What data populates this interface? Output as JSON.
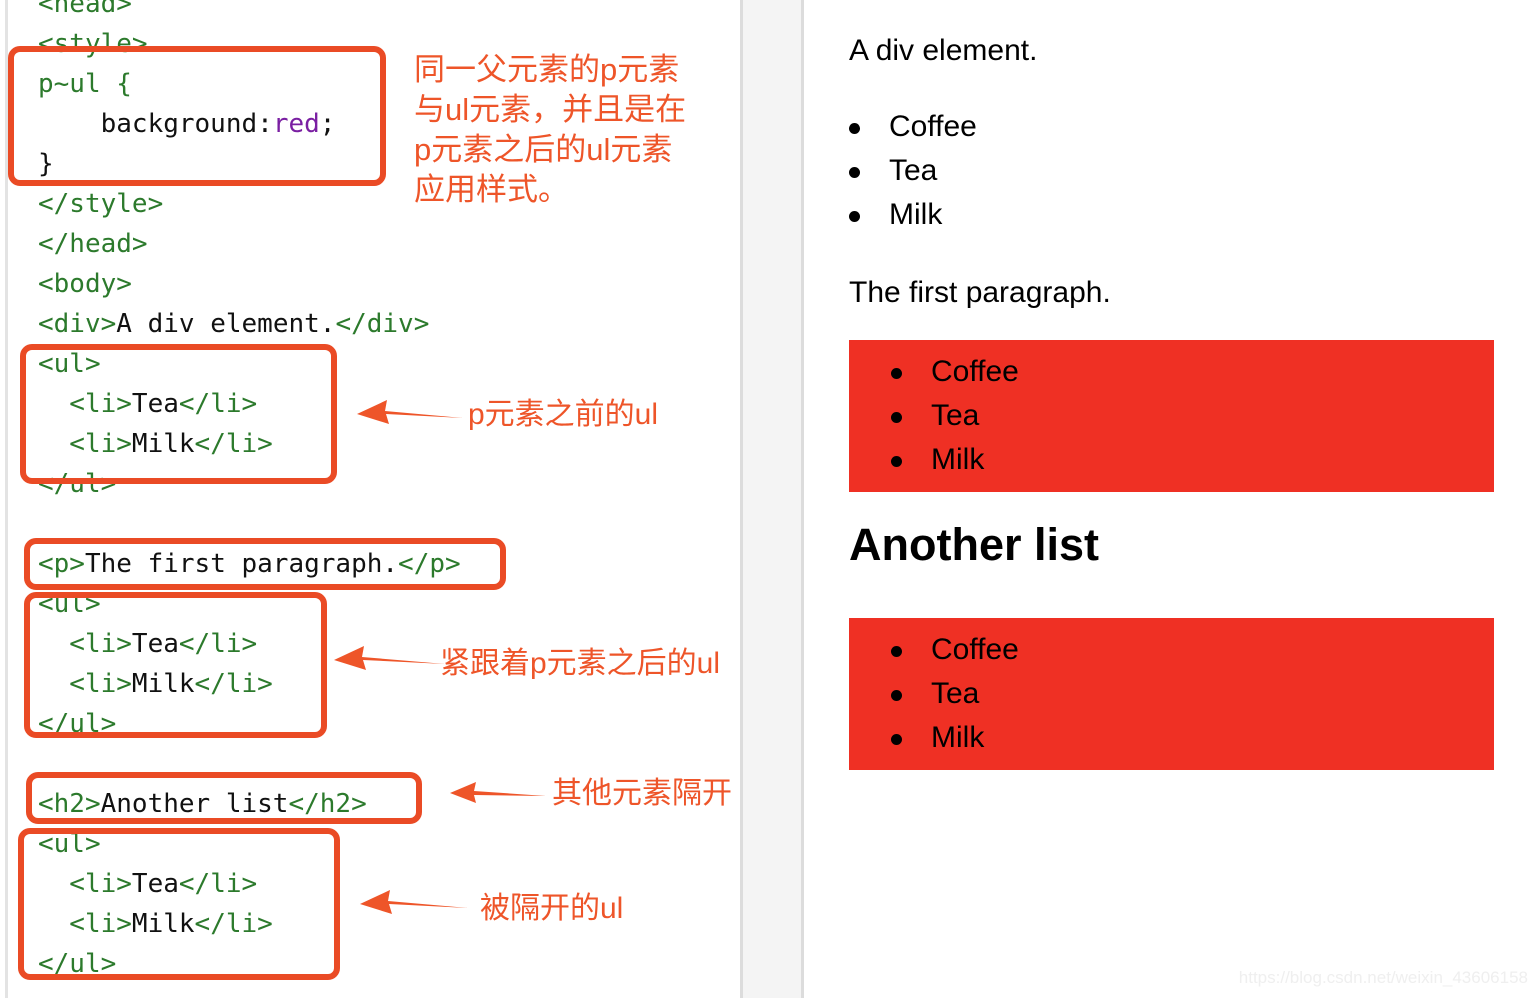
{
  "code_panel": {
    "lines": [
      {
        "id": "line-head-open",
        "segments": [
          {
            "cls": "tg",
            "t": "<head>"
          }
        ]
      },
      {
        "id": "line-style-open",
        "segments": [
          {
            "cls": "tg",
            "t": "<style>"
          }
        ]
      },
      {
        "id": "line-selector",
        "segments": [
          {
            "cls": "tg",
            "t": "p~ul {"
          }
        ]
      },
      {
        "id": "line-declaration",
        "segments": [
          {
            "cls": "tx",
            "t": "    background:"
          },
          {
            "cls": "pr",
            "t": "red"
          },
          {
            "cls": "tx",
            "t": ";"
          }
        ]
      },
      {
        "id": "line-rule-close",
        "segments": [
          {
            "cls": "tx",
            "t": "}"
          }
        ]
      },
      {
        "id": "line-style-close",
        "segments": [
          {
            "cls": "tg",
            "t": "</style>"
          }
        ]
      },
      {
        "id": "line-head-close",
        "segments": [
          {
            "cls": "tg",
            "t": "</head>"
          }
        ]
      },
      {
        "id": "line-body-open",
        "segments": [
          {
            "cls": "tg",
            "t": "<body>"
          }
        ]
      },
      {
        "id": "line-div",
        "segments": [
          {
            "cls": "tg",
            "t": "<div>"
          },
          {
            "cls": "tx",
            "t": "A div element."
          },
          {
            "cls": "tg",
            "t": "</div>"
          }
        ]
      },
      {
        "id": "line-ul1-open",
        "segments": [
          {
            "cls": "tg",
            "t": "<ul>"
          }
        ]
      },
      {
        "id": "line-ul1-li-tea",
        "segments": [
          {
            "cls": "tg",
            "t": "  <li>"
          },
          {
            "cls": "tx",
            "t": "Tea"
          },
          {
            "cls": "tg",
            "t": "</li>"
          }
        ]
      },
      {
        "id": "line-ul1-li-milk",
        "segments": [
          {
            "cls": "tg",
            "t": "  <li>"
          },
          {
            "cls": "tx",
            "t": "Milk"
          },
          {
            "cls": "tg",
            "t": "</li>"
          }
        ]
      },
      {
        "id": "line-ul1-close",
        "segments": [
          {
            "cls": "tg",
            "t": "</ul>"
          }
        ]
      },
      {
        "id": "line-blank-1",
        "segments": [
          {
            "cls": "tx",
            "t": " "
          }
        ]
      },
      {
        "id": "line-p",
        "segments": [
          {
            "cls": "tg",
            "t": "<p>"
          },
          {
            "cls": "tx",
            "t": "The first paragraph."
          },
          {
            "cls": "tg",
            "t": "</p>"
          }
        ]
      },
      {
        "id": "line-ul2-open",
        "segments": [
          {
            "cls": "tg",
            "t": "<ul>"
          }
        ]
      },
      {
        "id": "line-ul2-li-tea",
        "segments": [
          {
            "cls": "tg",
            "t": "  <li>"
          },
          {
            "cls": "tx",
            "t": "Tea"
          },
          {
            "cls": "tg",
            "t": "</li>"
          }
        ]
      },
      {
        "id": "line-ul2-li-milk",
        "segments": [
          {
            "cls": "tg",
            "t": "  <li>"
          },
          {
            "cls": "tx",
            "t": "Milk"
          },
          {
            "cls": "tg",
            "t": "</li>"
          }
        ]
      },
      {
        "id": "line-ul2-close",
        "segments": [
          {
            "cls": "tg",
            "t": "</ul>"
          }
        ]
      },
      {
        "id": "line-blank-2",
        "segments": [
          {
            "cls": "tx",
            "t": " "
          }
        ]
      },
      {
        "id": "line-h2",
        "segments": [
          {
            "cls": "tg",
            "t": "<h2>"
          },
          {
            "cls": "tx",
            "t": "Another list"
          },
          {
            "cls": "tg",
            "t": "</h2>"
          }
        ]
      },
      {
        "id": "line-ul3-open",
        "segments": [
          {
            "cls": "tg",
            "t": "<ul>"
          }
        ]
      },
      {
        "id": "line-ul3-li-tea",
        "segments": [
          {
            "cls": "tg",
            "t": "  <li>"
          },
          {
            "cls": "tx",
            "t": "Tea"
          },
          {
            "cls": "tg",
            "t": "</li>"
          }
        ]
      },
      {
        "id": "line-ul3-li-milk",
        "segments": [
          {
            "cls": "tg",
            "t": "  <li>"
          },
          {
            "cls": "tx",
            "t": "Milk"
          },
          {
            "cls": "tg",
            "t": "</li>"
          }
        ]
      },
      {
        "id": "line-ul3-close",
        "segments": [
          {
            "cls": "tg",
            "t": "</ul>"
          }
        ]
      }
    ]
  },
  "annotations": {
    "accent_color": "#ea4b25",
    "note_color": "#ee5529",
    "rule_note": "同一父元素的p元素\n与ul元素，并且是在\np元素之后的ul元素\n应用样式。",
    "ul_before_p": "p元素之前的ul",
    "ul_after_p": "紧跟着p元素之后的ul",
    "separated_by": "其他元素隔开",
    "separated_ul": "被隔开的ul"
  },
  "preview": {
    "div_text": "A div element.",
    "list_before_p": [
      "Coffee",
      "Tea",
      "Milk"
    ],
    "paragraph": "The first paragraph.",
    "list_after_p": [
      "Coffee",
      "Tea",
      "Milk"
    ],
    "heading": "Another list",
    "list_separated": [
      "Coffee",
      "Tea",
      "Milk"
    ],
    "highlight_color": "#ef3024"
  },
  "watermark": {
    "text": "https://blog.csdn.net/weixin_43606158"
  }
}
